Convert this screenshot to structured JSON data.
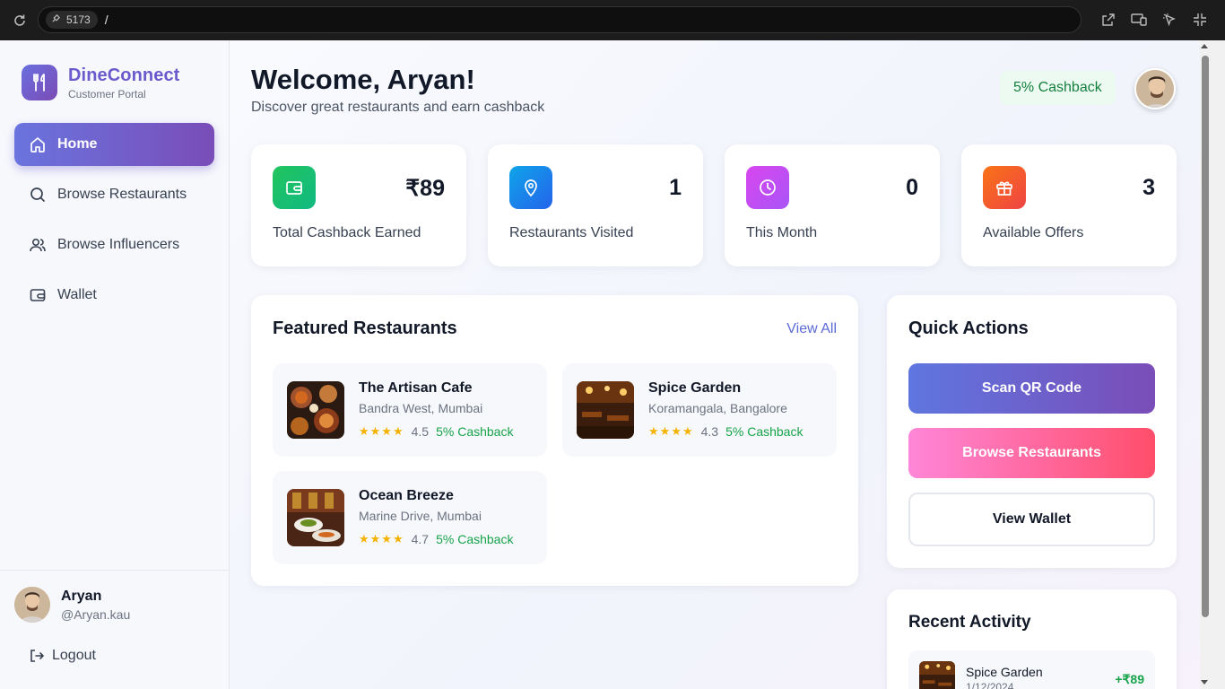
{
  "browser": {
    "port": "5173",
    "path": "/"
  },
  "brand": {
    "name": "DineConnect",
    "subtitle": "Customer Portal"
  },
  "nav": {
    "items": [
      {
        "label": "Home",
        "icon": "home-icon",
        "active": true
      },
      {
        "label": "Browse Restaurants",
        "icon": "search-icon",
        "active": false
      },
      {
        "label": "Browse Influencers",
        "icon": "users-icon",
        "active": false
      },
      {
        "label": "Wallet",
        "icon": "wallet-icon",
        "active": false
      }
    ]
  },
  "user": {
    "name": "Aryan",
    "handle": "@Aryan.kau"
  },
  "logout_label": "Logout",
  "header": {
    "title": "Welcome, Aryan!",
    "subtitle": "Discover great restaurants and earn cashback",
    "cashback_badge": "5% Cashback"
  },
  "stats": [
    {
      "value": "₹89",
      "label": "Total Cashback Earned",
      "icon": "wallet-icon",
      "color": "#22c55e"
    },
    {
      "value": "1",
      "label": "Restaurants Visited",
      "icon": "map-pin-icon",
      "color": "#0ea5e9"
    },
    {
      "value": "0",
      "label": "This Month",
      "icon": "clock-icon",
      "color": "#d946ef"
    },
    {
      "value": "3",
      "label": "Available Offers",
      "icon": "gift-icon",
      "color": "#f97316"
    }
  ],
  "featured": {
    "title": "Featured Restaurants",
    "view_all": "View All",
    "restaurants": [
      {
        "name": "The Artisan Cafe",
        "location": "Bandra West, Mumbai",
        "stars": "★★★★",
        "rating": "4.5",
        "cashback": "5% Cashback"
      },
      {
        "name": "Spice Garden",
        "location": "Koramangala, Bangalore",
        "stars": "★★★★",
        "rating": "4.3",
        "cashback": "5% Cashback"
      },
      {
        "name": "Ocean Breeze",
        "location": "Marine Drive, Mumbai",
        "stars": "★★★★",
        "rating": "4.7",
        "cashback": "5% Cashback"
      }
    ]
  },
  "quick_actions": {
    "title": "Quick Actions",
    "scan": "Scan QR Code",
    "browse": "Browse Restaurants",
    "wallet": "View Wallet"
  },
  "recent": {
    "title": "Recent Activity",
    "items": [
      {
        "name": "Spice Garden",
        "date": "1/12/2024",
        "amount": "+₹89"
      }
    ]
  },
  "colors": {
    "brand": "#6a5acd",
    "success": "#16a34a",
    "star": "#f5b301"
  }
}
